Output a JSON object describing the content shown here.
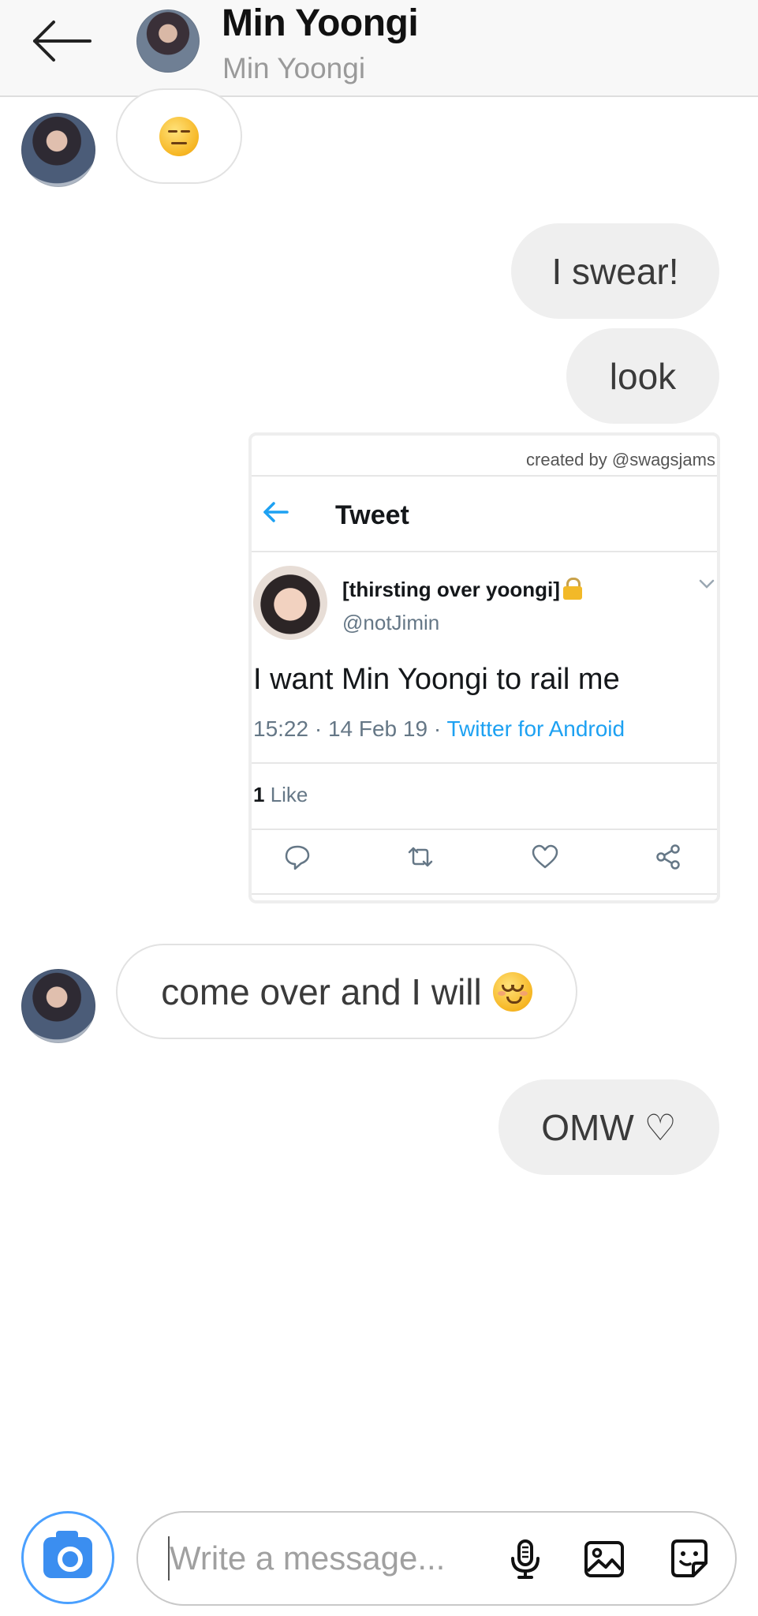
{
  "header": {
    "name": "Min Yoongi",
    "subtitle": "Min Yoongi"
  },
  "messages": {
    "m1_emoji": "expressionless-face",
    "m2": "I swear!",
    "m3": "look",
    "m5": "come over and I will",
    "m5_emoji": "relieved-face",
    "m6": "OMW ♡"
  },
  "tweet": {
    "credit": "created by @swagsjams",
    "title": "Tweet",
    "display_name": "[thirsting over yoongi]",
    "handle": "@notJimin",
    "text": "I want Min Yoongi to rail me",
    "meta_time": "15:22 · 14 Feb 19 · ",
    "meta_source": "Twitter for Android",
    "like_count": "1",
    "like_label": " Like",
    "colors": {
      "link": "#1da1f2",
      "muted": "#657786"
    }
  },
  "composer": {
    "placeholder": "Write a message..."
  },
  "colors": {
    "camera_accent": "#3b8ef0",
    "outgoing_bubble": "#efefef"
  }
}
